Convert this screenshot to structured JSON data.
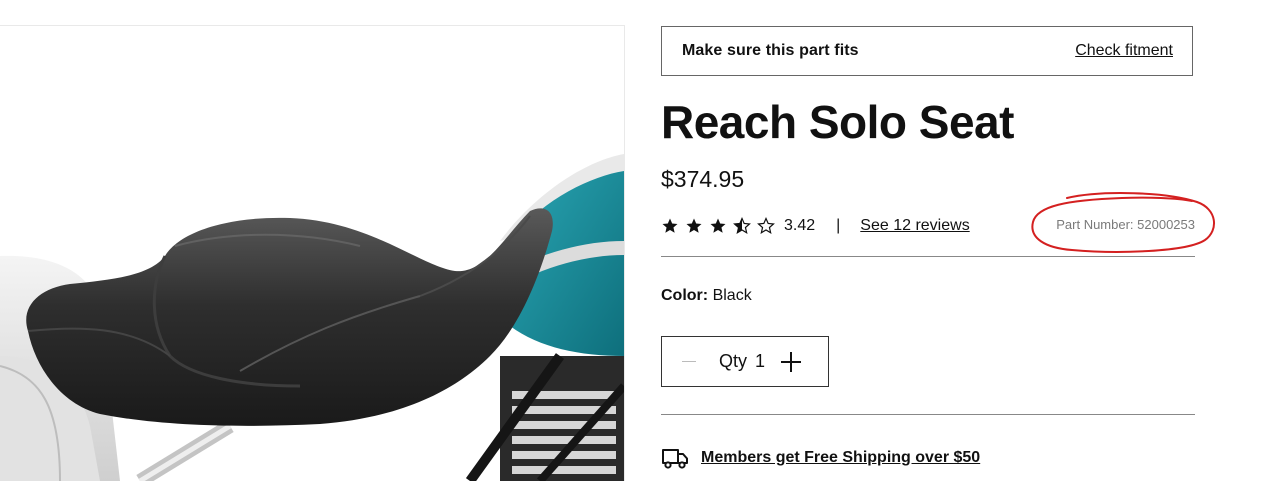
{
  "fitment": {
    "label": "Make sure this part fits",
    "link": "Check fitment"
  },
  "product": {
    "title": "Reach Solo Seat",
    "price": "$374.95",
    "rating": {
      "stars_shown": 3.5,
      "stars_max": 5,
      "value": "3.42",
      "separator": "|",
      "reviews_link": "See 12 reviews"
    },
    "part_number": "Part Number: 52000253",
    "color": {
      "label": "Color:",
      "value": "Black"
    },
    "quantity": {
      "label": "Qty",
      "value": "1"
    }
  },
  "shipping": {
    "text": "Members get Free Shipping over $50",
    "icon": "truck-icon"
  },
  "annotation": {
    "color": "#d42020"
  },
  "colors": {
    "accent_teal": "#1a8a99",
    "text": "#111111",
    "muted": "#7a7a7a"
  }
}
